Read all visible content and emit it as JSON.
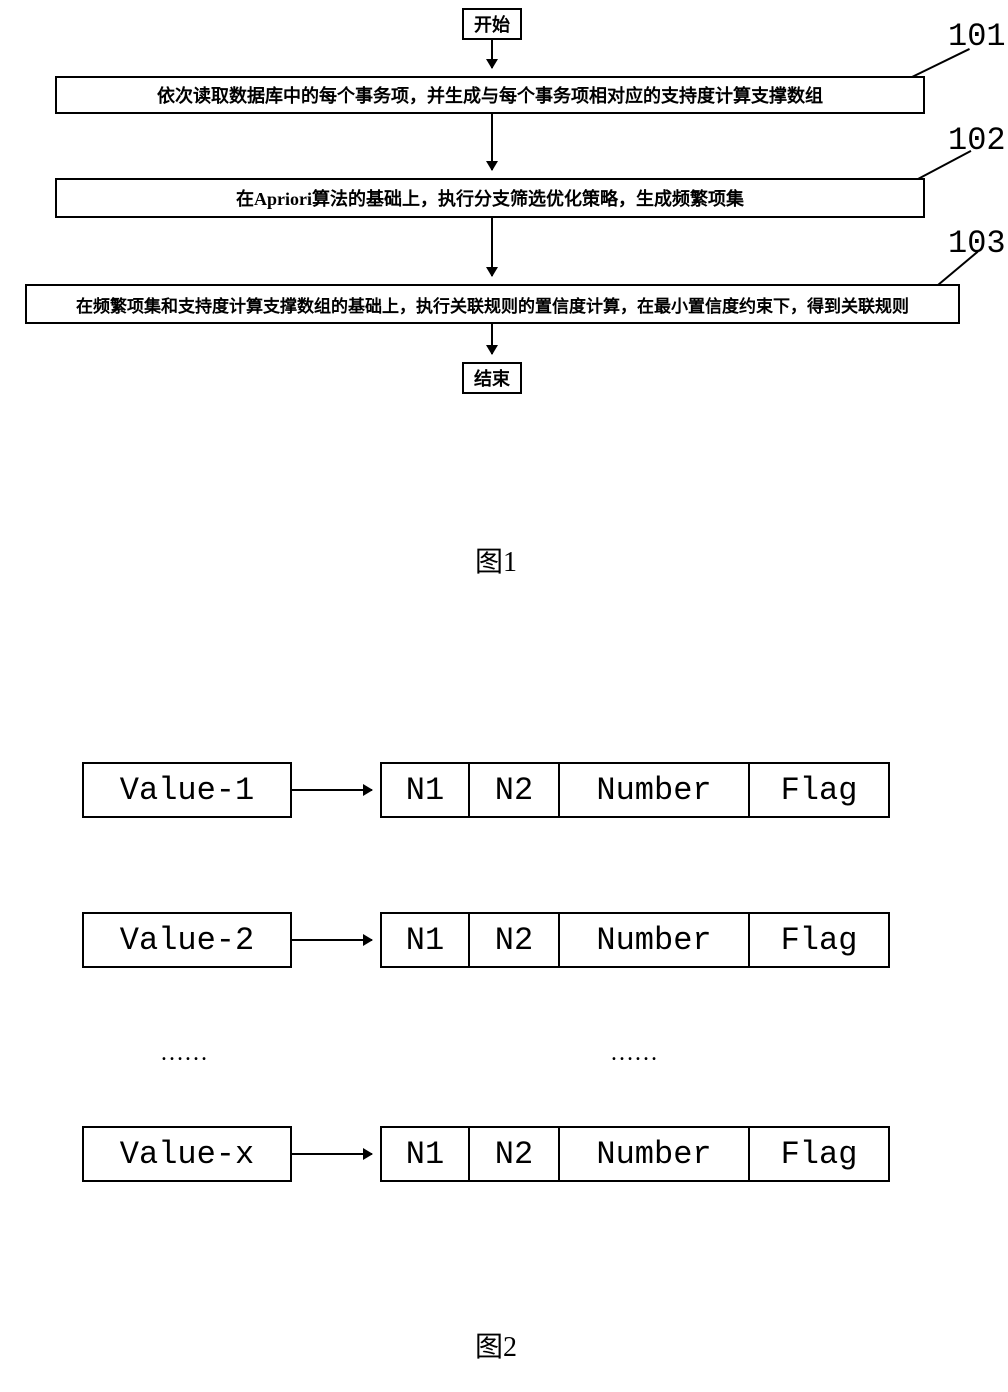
{
  "flowchart": {
    "start": "开始",
    "end": "结束",
    "steps": [
      {
        "ref": "101",
        "text": "依次读取数据库中的每个事务项，并生成与每个事务项相对应的支持度计算支撑数组"
      },
      {
        "ref": "102",
        "text": "在Apriori算法的基础上，执行分支筛选优化策略，生成频繁项集"
      },
      {
        "ref": "103",
        "text": "在频繁项集和支持度计算支撑数组的基础上，执行关联规则的置信度计算，在最小置信度约束下，得到关联规则"
      }
    ]
  },
  "captions": {
    "fig1": "图1",
    "fig2": "图2"
  },
  "table": {
    "headers": [
      "N1",
      "N2",
      "Number",
      "Flag"
    ],
    "rows": [
      {
        "value": "Value-1"
      },
      {
        "value": "Value-2"
      },
      {
        "value": "Value-x"
      }
    ],
    "ellipsis": "……"
  }
}
